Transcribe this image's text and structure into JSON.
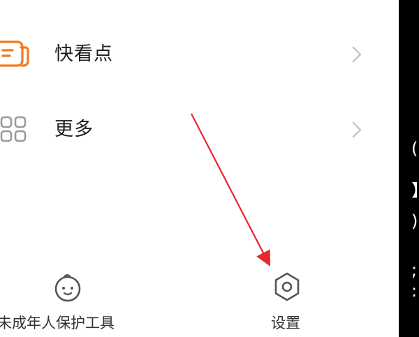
{
  "menu": {
    "items": [
      {
        "label": "快看点",
        "icon": "quick-look-icon"
      },
      {
        "label": "更多",
        "icon": "grid-icon"
      }
    ]
  },
  "bottom_bar": {
    "minor_protection_label": "未成年人保护工具",
    "minor_protection_icon": "child-face-icon",
    "settings_label": "设置",
    "settings_icon": "settings-hexagon-icon"
  },
  "annotation": {
    "arrow_color": "#e8262b",
    "meaning": "points to settings"
  },
  "colors": {
    "accent_orange": "#f07a20",
    "text": "#1e1e1e",
    "icon_gray": "#555555",
    "chevron_gray": "#c4c4c4"
  }
}
